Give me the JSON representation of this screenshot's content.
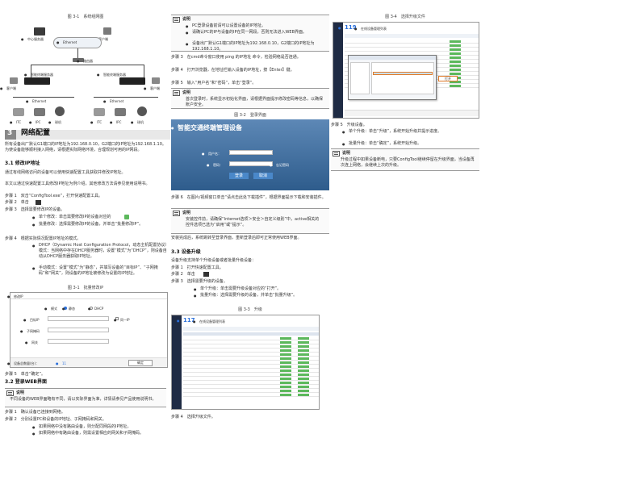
{
  "col1": {
    "fig1_caption": "图 3-1　系统组网图",
    "fig1_labels": {
      "pc_mgmt": "中心服务器",
      "client": "客户端",
      "ethernet": "Ethernet",
      "router": "路由器",
      "nvr1": "智能终端服务器",
      "nvr2": "智能终端服务器",
      "client2": "客户端",
      "client3": "客户端",
      "eth2": "Ethernet",
      "eth3": "Ethernet",
      "cam1": "ITC",
      "cam2": "IPC",
      "cam3": "球机",
      "cam4": "ITC",
      "cam5": "IPC",
      "cam6": "球机"
    },
    "chapter_num": "3",
    "chapter_title": "网络配置",
    "intro": "所有设备出厂默认G1端口的IP地址为192.168.0.10，G2端口的IP地址为192.168.1.10。为使设备能够顺利接入网络，请根据实际网络环境，合理规划可用的IP网段。",
    "s31_title": "3.1 修改IP地址",
    "s31_p1": "通过有线网络访问的设备可以使用快速配置工具获取并修改IP地址。",
    "s31_p2": "本文以通过快速配置工具修改IP地址为例介绍，其他修改方法请参见使用说明书。",
    "step1": "步骤 1　双击“ConfigTool.exe”，打开快速配置工具。",
    "step2": "步骤 2　单击",
    "step3": "步骤 3　选择需要修改IP的设备。",
    "b_single": "单个修改：单击需要修改IP的设备对应的",
    "b_batch": "批量修改：选择需要修改IP的设备，并单击“批量修改IP”。",
    "step4": "步骤 4　根据实际情况配置IP地址的模式。",
    "b_dhcp": "DHCP（Dynamic Host Configuration Protocol，动态主机配置协议）模式：当网络中存在DHCP服务器时，设置“模式”为“DHCP”，则设备自动从DHCP服务器获取IP地址。",
    "b_static": "手动模式：设置“模式”为“静态”，并填写设备的“目标IP”、“子网掩码”和“网关”，则设备的IP地址被修改为设置的IP地址。",
    "fig2_caption": "图 3-1　批量修改IP",
    "dialog": {
      "title": "修改IP",
      "mode_label": "模式",
      "static": "静态",
      "dhcp": "DHCP",
      "target_ip": "目标IP",
      "same": "同一IP",
      "mask": "子网掩码",
      "gateway": "网关",
      "count_label": "设备总数量(台)：",
      "count": "11",
      "ok": "确定"
    },
    "step5": "步骤 5　单击“确定”。",
    "s32_title": "3.2 登录WEB界面",
    "note_label": "说明",
    "note1": "不同设备的WEB界面略有不同，请以实际界面为准，详情请参见产品使用说明书。",
    "s32_step1": "步骤 1　确认设备已连接到网络。",
    "s32_step2": "步骤 2　分别设置PC和设备的IP地址、子网掩码和网关。",
    "b_nogw": "如果网络中没有路由设备，则分配同网段的IP地址。",
    "b_gw": "如果网络中有路由设备，则需设置相应的网关和子网掩码。"
  },
  "col2": {
    "note_label": "说明",
    "note_b1": "PC登录设备前请可以设置设备的IP地址。",
    "note_b2": "请确认PC的IP与设备的IP在同一网段，否则无法进入WEB界面。",
    "note_b3": "设备出厂默认G1端口的IP地址为192.168.0.10，G2端口的IP地址为192.168.1.10。",
    "step3": "步骤 3　在cmd命令窗口使用 ping 的IP地址 命令，检验网络是否连通。",
    "step4": "步骤 4　打开浏览器，在地址栏输入设备的IP地址，按【Enter】键。",
    "step5": "步骤 5　输入“用户名”和“密码”，单击“登录”。",
    "note2_label": "说明",
    "note2": "首次登录时，系统显示初始化界面，请根据界面提示修改密码等信息，以确保账户安全。",
    "fig_caption": "图 3-2　登录界面",
    "login": {
      "title": "智能交通终端管理设备",
      "user": "用户名：",
      "pwd": "密码：",
      "forget": "忘记密码",
      "btn_login": "登录",
      "btn_cancel": "取消"
    },
    "step6": "步骤 6　在图片/视频窗口单击“请点击此处下载插件”，根据界面提示下载和安装插件。",
    "note3_label": "说明",
    "note3": "安装控件前，请确保“Internet选项＞安全＞自定义级别”中，active相关的控件选项已选为“启用”或“提示”。",
    "after_install": "安装完成后，系统跳转至登录界面，重新登录后即可正常使用WEB界面。",
    "s33_title": "3.3 设备升级",
    "s33_p": "设备升级支持单个升级设备或者批量升级设备：",
    "s33_step1": "步骤 1　打开快速配置工具。",
    "s33_step2": "步骤 2　单击",
    "s33_step3": "步骤 3　选择需要升级的设备。",
    "b_up1": "单个升级：单击需要升级设备对应的“打开”。",
    "b_up2": "批量升级：选择需要升级的设备，并单击“批量升级”。",
    "fig3_caption": "图 3-3　升级",
    "fig3_count": "117",
    "fig3_title": "在线设备管理列表",
    "fig3_btn": "打开",
    "step4b": "步骤 4　选择升级文件。"
  },
  "col3": {
    "fig_caption": "图 3-4　选择升级文件",
    "fig_count": "119",
    "fig_title": "在线设备管理列表",
    "fig_btn": "打开",
    "step5": "步骤 5　升级设备。",
    "b1": "单个升级：单击“升级”，系统开始升级并提示进度。",
    "b2": "批量升级：单击“确定”，系统开始升级。",
    "note_label": "说明",
    "note": "升级过程中如果设备断电，只要ConfigTool继续停留在升级界面，当设备再次连上网络，会继续上次的升级。"
  }
}
